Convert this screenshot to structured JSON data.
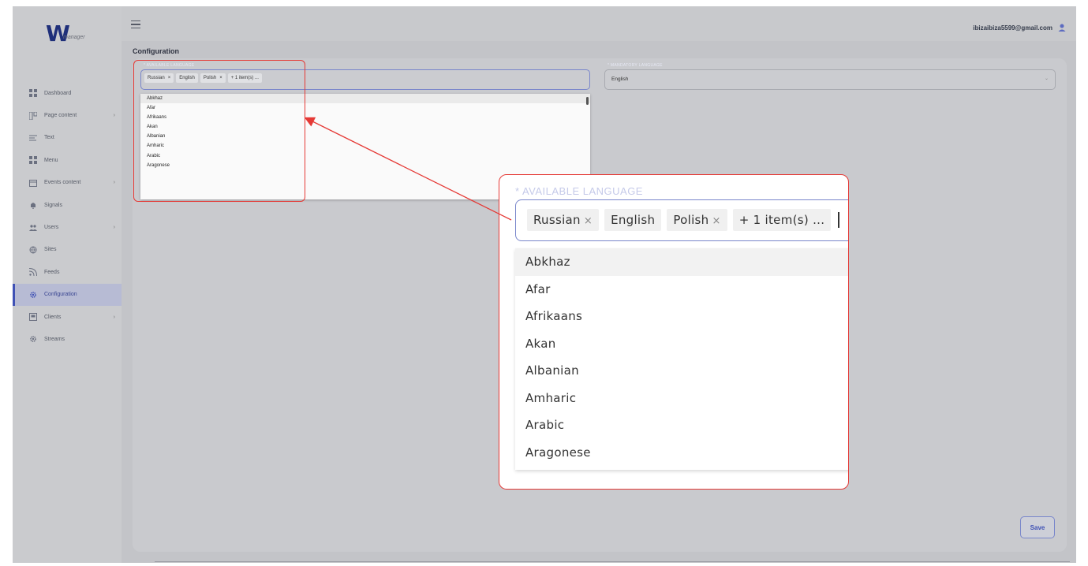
{
  "app": {
    "logo_letter": "W",
    "logo_sub": "manager"
  },
  "header": {
    "user_email": "ibizaibiza5599@gmail.com",
    "page_title": "Configuration"
  },
  "sidebar": {
    "items": [
      {
        "label": "Dashboard",
        "icon": "dashboard-icon",
        "arrow": ""
      },
      {
        "label": "Page content",
        "icon": "page-content-icon",
        "arrow": "›"
      },
      {
        "label": "Text",
        "icon": "text-icon",
        "arrow": ""
      },
      {
        "label": "Menu",
        "icon": "menu-icon",
        "arrow": ""
      },
      {
        "label": "Events content",
        "icon": "calendar-icon",
        "arrow": "›"
      },
      {
        "label": "Signals",
        "icon": "bell-icon",
        "arrow": ""
      },
      {
        "label": "Users",
        "icon": "users-icon",
        "arrow": "›"
      },
      {
        "label": "Sites",
        "icon": "globe-icon",
        "arrow": ""
      },
      {
        "label": "Feeds",
        "icon": "rss-icon",
        "arrow": ""
      },
      {
        "label": "Configuration",
        "icon": "gear-icon",
        "arrow": "",
        "active": true
      },
      {
        "label": "Clients",
        "icon": "clients-icon",
        "arrow": "›"
      },
      {
        "label": "Streams",
        "icon": "gear-icon",
        "arrow": ""
      }
    ]
  },
  "available_language": {
    "label": "* AVAILABLE LANGUAGE",
    "chips": [
      {
        "label": "Russian",
        "remove": "×"
      },
      {
        "label": "English",
        "remove": ""
      },
      {
        "label": "Polish",
        "remove": "×"
      },
      {
        "label": "+ 1 item(s) ...",
        "remove": ""
      }
    ],
    "options": [
      "Abkhaz",
      "Afar",
      "Afrikaans",
      "Akan",
      "Albanian",
      "Amharic",
      "Arabic",
      "Aragonese"
    ]
  },
  "mandatory_language": {
    "label": "* MANDATORY LANGUAGE",
    "value": "English"
  },
  "actions": {
    "save_label": "Save"
  },
  "colors": {
    "accent": "#3f51b5",
    "annotation": "#e53935"
  }
}
